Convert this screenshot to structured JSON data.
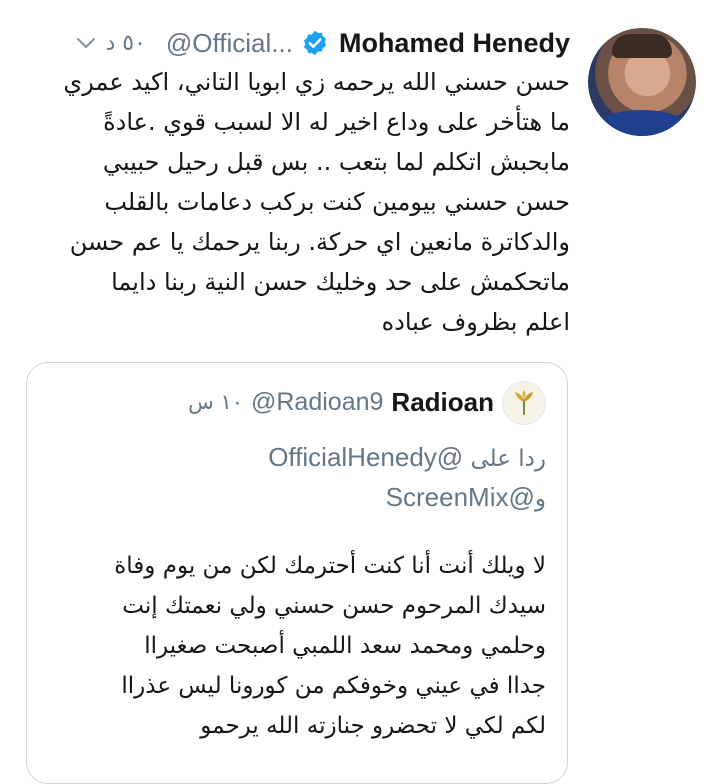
{
  "tweet": {
    "author_name": "Mohamed Henedy",
    "handle": "@Official...",
    "time": "٥٠ د",
    "text_lines": [
      "حسن حسني الله يرحمه زي ابويا التاني، اكيد عمري",
      "ما هتأخر على وداع اخير له الا لسبب قوي .عادةً",
      "مابحبش اتكلم لما بتعب .. بس قبل رحيل حبيبي",
      "حسن حسني بيومين كنت بركب دعامات بالقلب",
      "والدكاترة مانعين اي حركة. ربنا يرحمك يا عم حسن",
      "ماتحكمش على حد وخليك حسن النية ربنا دايما",
      "اعلم بظروف عباده"
    ]
  },
  "quoted": {
    "author_name": "Radioan",
    "handle": "@Radioan9",
    "time": "١٠ س",
    "reply_prefix": "ردا على",
    "reply_mention_1": "@OfficialHenedy",
    "reply_and": "و",
    "reply_mention_2": "@ScreenMix",
    "text_lines": [
      "لا ويلك أنت أنا كنت أحترمك لكن من يوم وفاة",
      "سيدك المرحوم حسن حسني ولي نعمتك إنت",
      "وحلمي ومحمد سعد اللمبي أصبحت صغيراا",
      "جداا في عيني وخوفكم من كورونا ليس عذراا",
      "لكم لكي لا تحضرو جنازته الله يرحمو"
    ]
  },
  "colors": {
    "verified_blue": "#1da1f2",
    "muted_text": "#657786",
    "border": "#ccd6dd"
  },
  "icons": {
    "verified": "verified-badge-icon",
    "menu": "chevron-down-icon"
  }
}
